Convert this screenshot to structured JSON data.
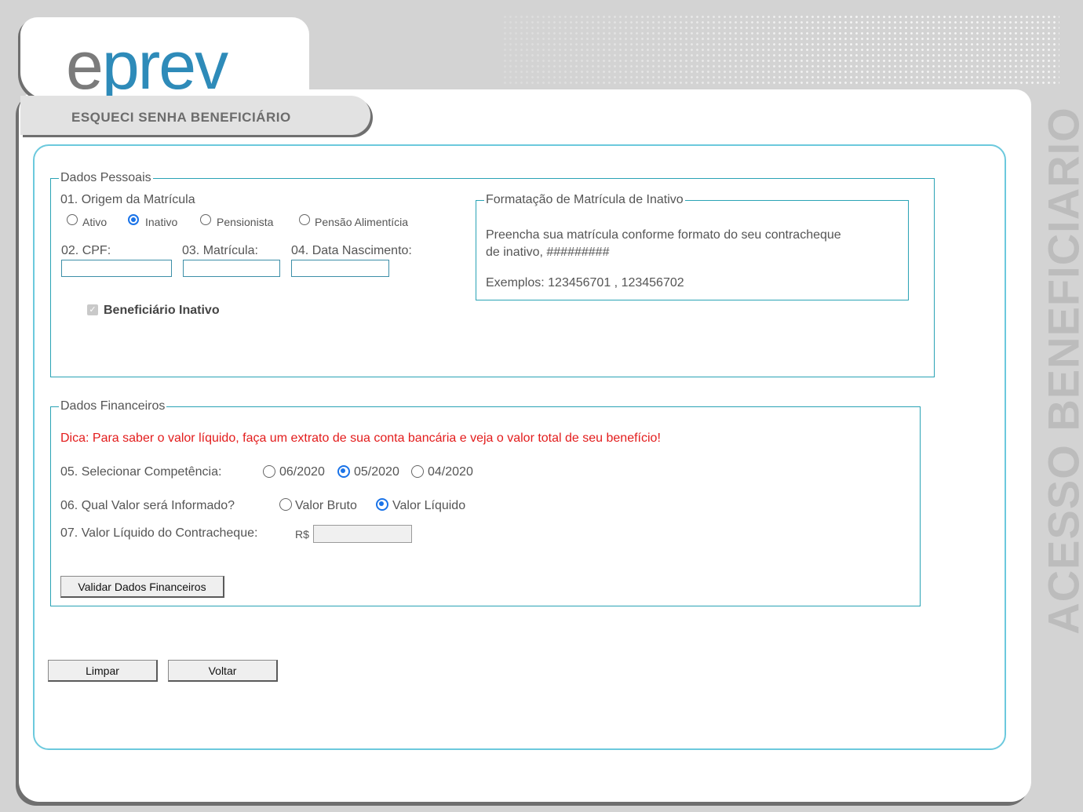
{
  "header": {
    "logo_e": "e",
    "logo_rest": "prev",
    "page_title": "ESQUECI SENHA BENEFICIÁRIO",
    "side_label": "ACESSO BENEFICIARIO"
  },
  "dados_pessoais": {
    "legend": "Dados Pessoais",
    "origem_label": "01. Origem da Matrícula",
    "origem_options": [
      "Ativo",
      "Inativo",
      "Pensionista",
      "Pensão Alimentícia"
    ],
    "origem_selected": "Inativo",
    "cpf_label": "02. CPF:",
    "matricula_label": "03. Matrícula:",
    "nascimento_label": "04. Data Nascimento:",
    "cpf_value": "",
    "matricula_value": "",
    "nascimento_value": "",
    "beneficiario_label": "Beneficiário Inativo",
    "beneficiario_checked": true
  },
  "formatacao": {
    "legend": "Formatação de Matrícula de Inativo",
    "line1": "Preencha sua matrícula conforme formato do seu contracheque",
    "line2": "de inativo, #########",
    "examples": "Exemplos: 123456701 , 123456702"
  },
  "dados_financeiros": {
    "legend": "Dados Financeiros",
    "tip": "Dica: Para saber o valor líquido, faça um extrato de sua conta bancária e veja o valor total de seu benefício!",
    "competencia_label": "05. Selecionar Competência:",
    "competencia_options": [
      "06/2020",
      "05/2020",
      "04/2020"
    ],
    "competencia_selected": "05/2020",
    "valor_tipo_label": "06. Qual Valor será Informado?",
    "valor_tipo_options": [
      "Valor Bruto",
      "Valor Líquido"
    ],
    "valor_tipo_selected": "Valor Líquido",
    "valor_liquido_label": "07. Valor Líquido do Contracheque:",
    "currency": "R$",
    "valor_liquido_value": "",
    "validar_button": "Validar Dados Financeiros"
  },
  "actions": {
    "limpar_button": "Limpar",
    "voltar_button": "Voltar"
  },
  "colors": {
    "accent": "#2aa3b5",
    "tip": "#e31c1c",
    "logo_blue": "#2e8bb9"
  }
}
